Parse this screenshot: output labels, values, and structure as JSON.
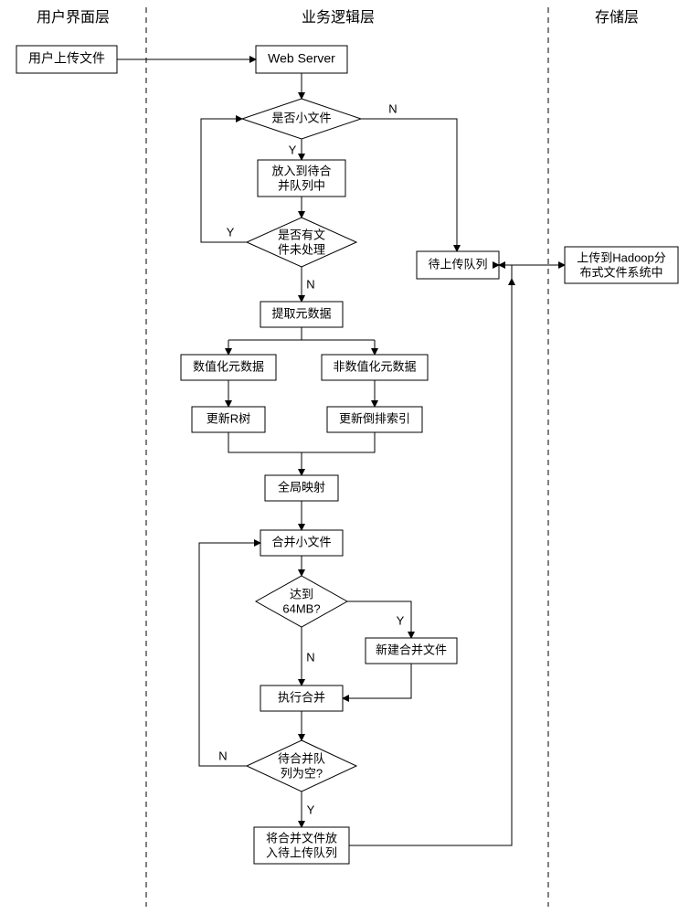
{
  "headers": {
    "ui_layer": "用户界面层",
    "logic_layer": "业务逻辑层",
    "storage_layer": "存储层"
  },
  "nodes": {
    "user_upload": "用户上传文件",
    "web_server": "Web Server",
    "is_small_file": "是否小文件",
    "put_merge_queue_l1": "放入到待合",
    "put_merge_queue_l2": "并队列中",
    "has_unprocessed_l1": "是否有文",
    "has_unprocessed_l2": "件未处理",
    "extract_metadata": "提取元数据",
    "numeric_metadata": "数值化元数据",
    "nonnumeric_metadata": "非数值化元数据",
    "update_rtree": "更新R树",
    "update_inverted_index": "更新倒排索引",
    "global_mapping": "全局映射",
    "merge_small_files": "合并小文件",
    "reach_64mb_l1": "达到",
    "reach_64mb_l2": "64MB?",
    "new_merge_file": "新建合并文件",
    "execute_merge": "执行合并",
    "queue_empty_l1": "待合并队",
    "queue_empty_l2": "列为空?",
    "put_upload_queue_l1": "将合并文件放",
    "put_upload_queue_l2": "入待上传队列",
    "upload_queue": "待上传队列",
    "upload_hadoop_l1": "上传到Hadoop分",
    "upload_hadoop_l2": "布式文件系统中"
  },
  "edges": {
    "Y": "Y",
    "N": "N"
  }
}
